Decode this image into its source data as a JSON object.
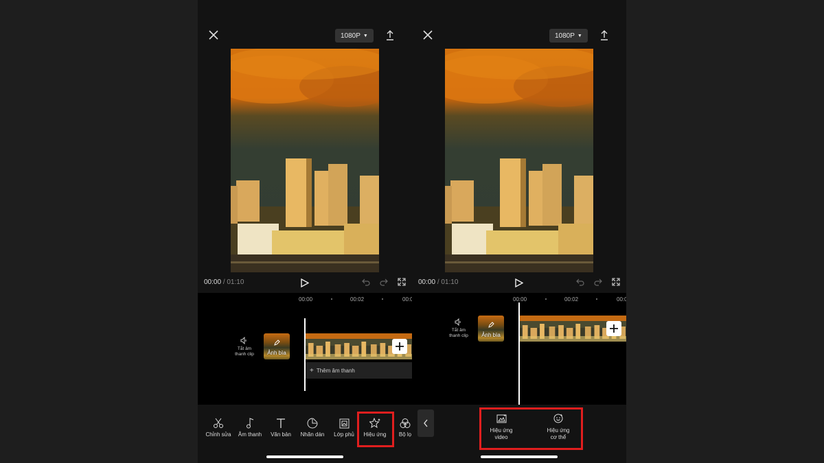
{
  "screens": [
    {
      "resolution": "1080P",
      "time_current": "00:00",
      "time_separator": "/",
      "time_total": "01:10",
      "ruler": [
        "00:00",
        "00:02",
        "00:0"
      ],
      "mute_label": "Tắt âm\nthanh clip",
      "cover_label": "Ảnh bìa",
      "add_audio": "Thêm âm thanh",
      "toolbar": [
        {
          "icon": "scissors-icon",
          "label": "Chỉnh sửa"
        },
        {
          "icon": "music-note-icon",
          "label": "Âm thanh"
        },
        {
          "icon": "text-icon",
          "label": "Văn bản"
        },
        {
          "icon": "sticker-icon",
          "label": "Nhãn dán"
        },
        {
          "icon": "overlay-icon",
          "label": "Lớp phủ"
        },
        {
          "icon": "sparkle-star-icon",
          "label": "Hiệu ứng",
          "highlighted": true
        },
        {
          "icon": "filter-icon",
          "label": "Bộ lọ"
        }
      ]
    },
    {
      "resolution": "1080P",
      "time_current": "00:00",
      "time_separator": "/",
      "time_total": "01:10",
      "ruler": [
        "00:00",
        "00:02",
        "00:0"
      ],
      "mute_label": "Tắt âm\nthanh clip",
      "cover_label": "Ảnh bìa",
      "effects_menu": [
        {
          "icon": "video-effect-icon",
          "label": "Hiệu ứng\nvideo"
        },
        {
          "icon": "body-effect-icon",
          "label": "Hiệu ứng\ncơ thể"
        }
      ]
    }
  ],
  "colors": {
    "highlight": "#e01e1e",
    "background": "#1e1e1e",
    "timeline": "#000000"
  }
}
